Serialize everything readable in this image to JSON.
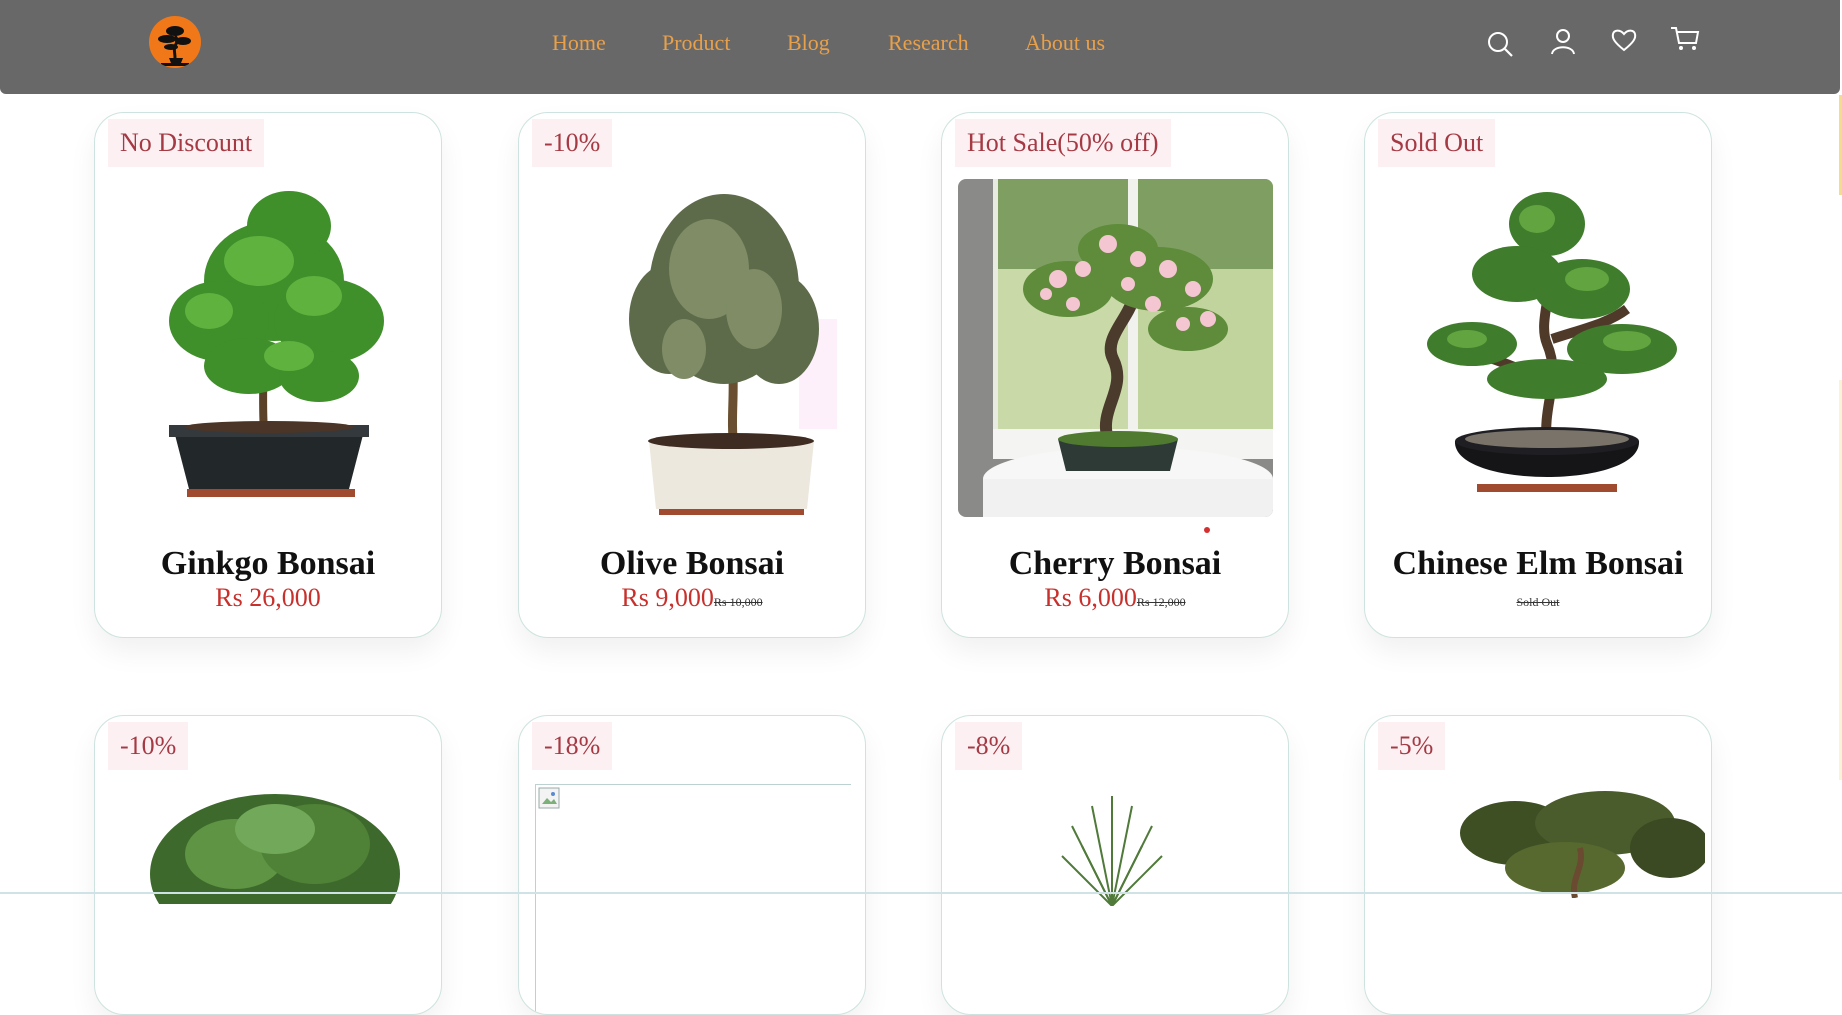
{
  "nav": {
    "links": [
      {
        "label": "Home"
      },
      {
        "label": "Product"
      },
      {
        "label": "Blog"
      },
      {
        "label": "Research"
      },
      {
        "label": "About us"
      }
    ],
    "icons": [
      "search-icon",
      "user-icon",
      "heart-icon",
      "cart-icon"
    ],
    "link_color": "#e8a04a",
    "bar_color": "#686868",
    "logo_color": "#f07818"
  },
  "products": [
    {
      "badge": "No Discount",
      "name": "Ginkgo Bonsai",
      "price": "Rs 26,000",
      "old_price": ""
    },
    {
      "badge": "-10%",
      "name": "Olive Bonsai",
      "price": "Rs 9,000",
      "old_price": "Rs 10,000"
    },
    {
      "badge": "Hot Sale(50% off)",
      "name": "Cherry Bonsai",
      "price": "Rs 6,000",
      "old_price": "Rs 12,000"
    },
    {
      "badge": "Sold Out",
      "name": "Chinese Elm Bonsai",
      "price": "",
      "old_price": "Sold Out"
    },
    {
      "badge": "-10%"
    },
    {
      "badge": "-18%"
    },
    {
      "badge": "-8%"
    },
    {
      "badge": "-5%"
    }
  ],
  "colors": {
    "badge_bg": "#fdf0f3",
    "badge_text": "#a53a44",
    "price": "#c8302c",
    "card_border": "#cde3df"
  }
}
